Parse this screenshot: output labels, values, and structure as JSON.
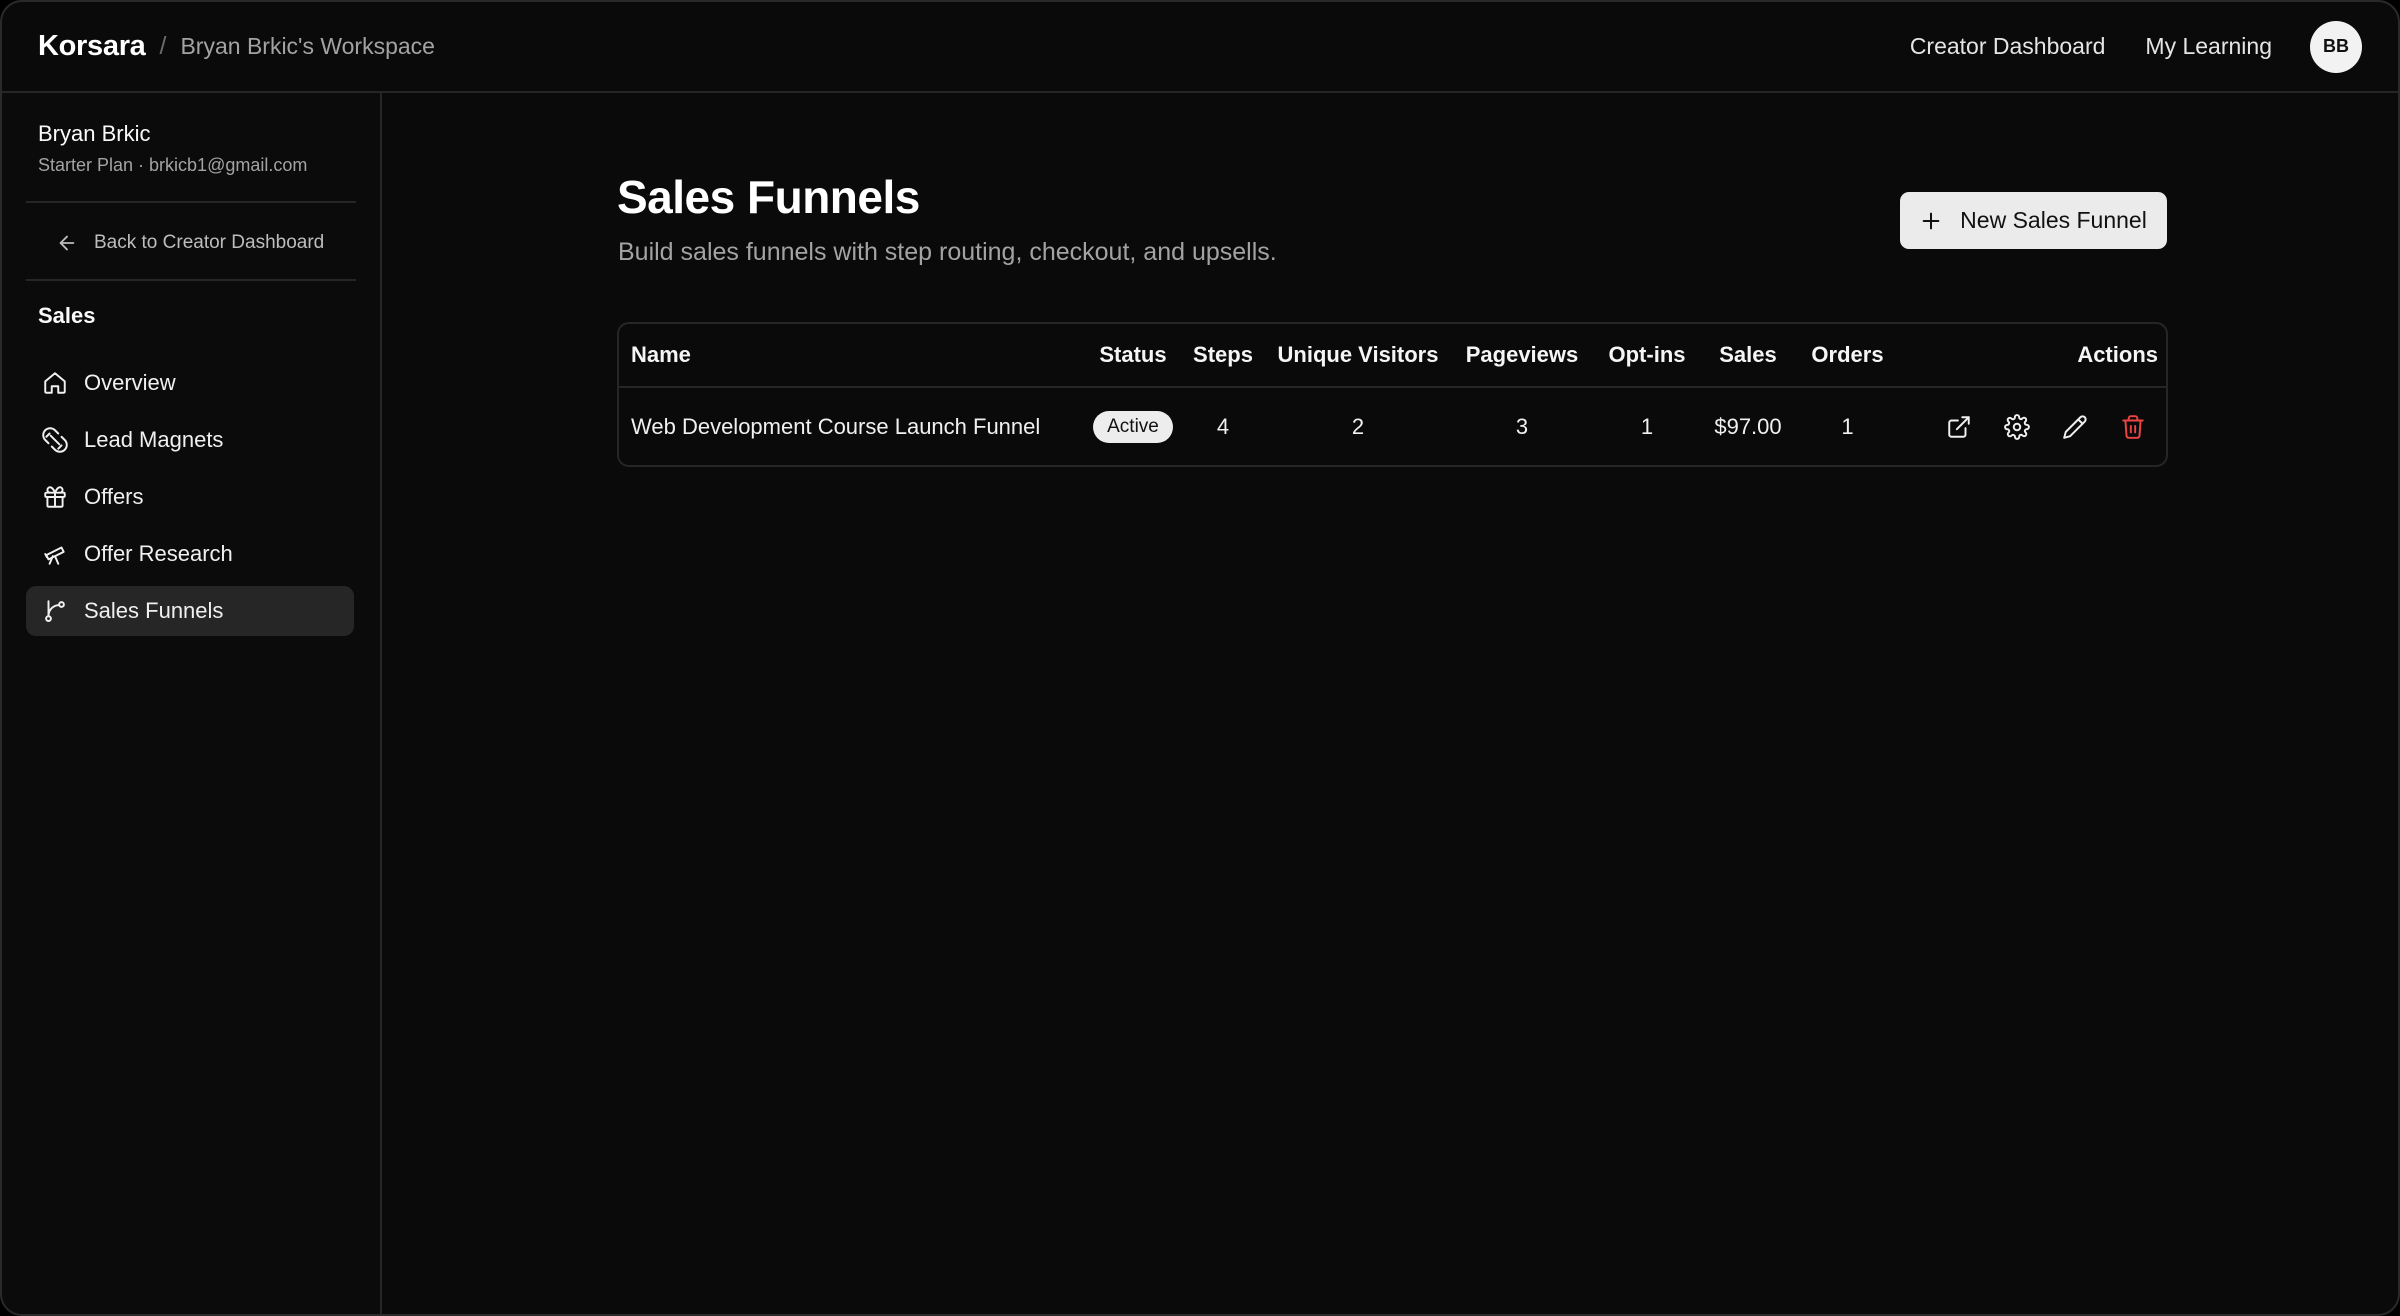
{
  "header": {
    "brand": "Korsara",
    "separator": "/",
    "workspace": "Bryan Brkic's Workspace",
    "links": [
      "Creator Dashboard",
      "My Learning"
    ],
    "avatar_initials": "BB"
  },
  "sidebar": {
    "user_name": "Bryan Brkic",
    "user_plan": "Starter Plan · brkicb1@gmail.com",
    "back_label": "Back to Creator Dashboard",
    "section": "Sales",
    "items": [
      {
        "label": "Overview",
        "icon": "home-icon"
      },
      {
        "label": "Lead Magnets",
        "icon": "magnet-icon"
      },
      {
        "label": "Offers",
        "icon": "gift-icon"
      },
      {
        "label": "Offer Research",
        "icon": "telescope-icon"
      },
      {
        "label": "Sales Funnels",
        "icon": "git-branch-icon",
        "active": true
      }
    ]
  },
  "main": {
    "title": "Sales Funnels",
    "subtitle": "Build sales funnels with step routing, checkout, and upsells.",
    "new_button": "New Sales Funnel",
    "table": {
      "columns": [
        "Name",
        "Status",
        "Steps",
        "Unique Visitors",
        "Pageviews",
        "Opt-ins",
        "Sales",
        "Orders",
        "Actions"
      ],
      "rows": [
        {
          "name": "Web Development Course Launch Funnel",
          "status": "Active",
          "steps": "4",
          "unique_visitors": "2",
          "pageviews": "3",
          "optins": "1",
          "sales": "$97.00",
          "orders": "1"
        }
      ],
      "action_icons": [
        "external-link-icon",
        "gear-icon",
        "pencil-icon",
        "trash-icon"
      ]
    }
  },
  "colors": {
    "background": "#0a0a0a",
    "border": "#262626",
    "active_nav": "#262626",
    "danger": "#ef4444",
    "button_bg": "#ebebeb"
  }
}
